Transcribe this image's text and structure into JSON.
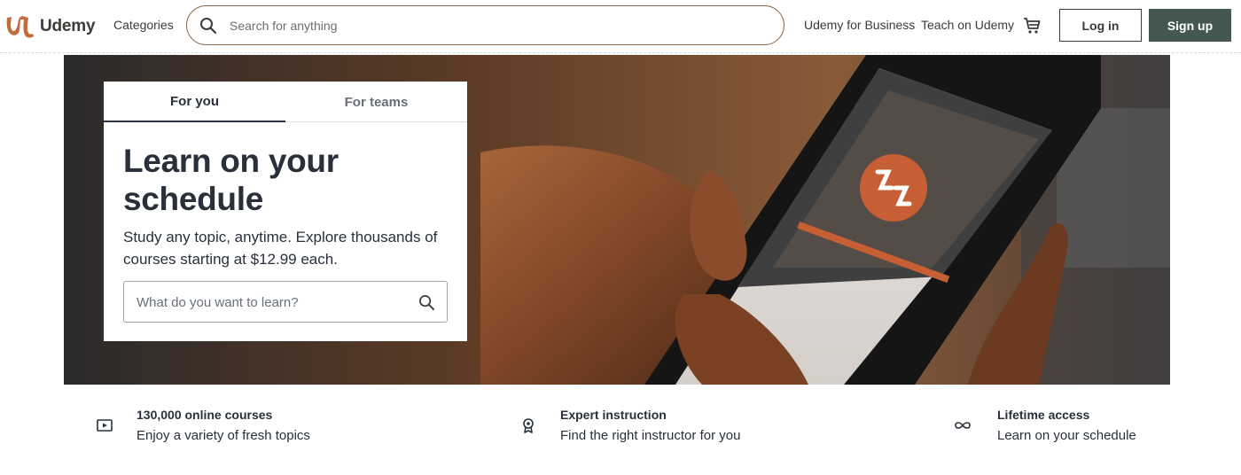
{
  "header": {
    "logo_text": "Udemy",
    "categories_label": "Categories",
    "search_placeholder": "Search for anything",
    "business_link": "Udemy for Business",
    "teach_link": "Teach on Udemy",
    "login_label": "Log in",
    "signup_label": "Sign up"
  },
  "hero": {
    "tabs": [
      {
        "label": "For you",
        "active": true
      },
      {
        "label": "For teams",
        "active": false
      }
    ],
    "title": "Learn on your schedule",
    "subtitle": "Study any topic, anytime. Explore thousands of courses starting at $12.99 each.",
    "search_placeholder": "What do you want to learn?"
  },
  "features": [
    {
      "icon": "video-player-icon",
      "title": "130,000 online courses",
      "description": "Enjoy a variety of fresh topics"
    },
    {
      "icon": "award-ribbon-icon",
      "title": "Expert instruction",
      "description": "Find the right instructor for you"
    },
    {
      "icon": "infinity-icon",
      "title": "Lifetime access",
      "description": "Learn on your schedule"
    }
  ],
  "colors": {
    "brand": "#c26a3a",
    "signup_bg": "#45584f",
    "text": "#29303b",
    "search_border": "#8a6a4e"
  }
}
